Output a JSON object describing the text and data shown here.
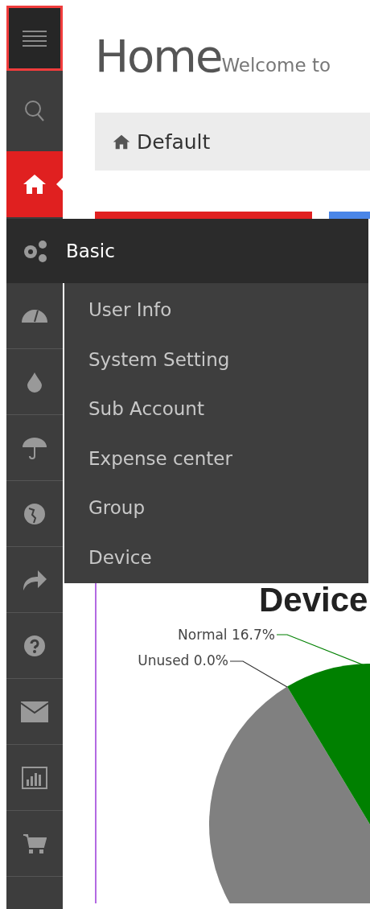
{
  "header": {
    "title": "Home",
    "subtitle": "Welcome to"
  },
  "breadcrumb": {
    "label": "Default"
  },
  "sidebar": {
    "items": [
      {
        "selected": false
      },
      {
        "selected": true
      },
      {
        "selected": false
      },
      {
        "selected": false
      },
      {
        "selected": false
      },
      {
        "selected": false
      },
      {
        "selected": false
      },
      {
        "selected": false
      },
      {
        "selected": false
      },
      {
        "selected": false
      },
      {
        "selected": false
      }
    ]
  },
  "flyout_menu": {
    "title": "Basic",
    "items": [
      "User Info",
      "System Setting",
      "Sub Account",
      "Expense center",
      "Group",
      "Device"
    ]
  },
  "chart": {
    "title": "Device",
    "labels": [
      {
        "text": "Normal 16.7%",
        "color": "#008000"
      },
      {
        "text": "Unused 0.0%",
        "color": "#333333"
      }
    ]
  }
}
